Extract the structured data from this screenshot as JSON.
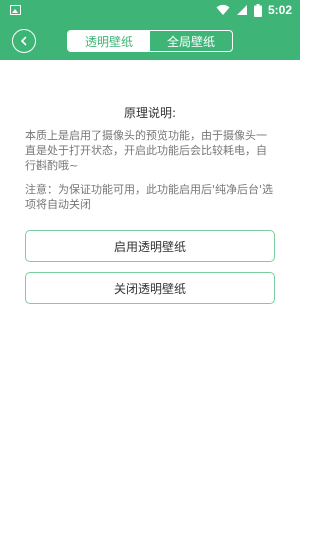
{
  "status_bar": {
    "time": "5:02",
    "icons": [
      "image-notification-icon",
      "wifi-icon",
      "signal-icon",
      "battery-icon"
    ]
  },
  "header": {
    "back_icon": "chevron-left-icon",
    "tabs": [
      {
        "label": "透明壁纸",
        "active": true
      },
      {
        "label": "全局壁纸",
        "active": false
      }
    ]
  },
  "content": {
    "title": "原理说明:",
    "description": "本质上是启用了摄像头的预览功能，由于摄像头一直是处于打开状态，开启此功能后会比较耗电，自行斟酌哦~",
    "note": "注意：为保证功能可用，此功能启用后'纯净后台'选项将自动关闭"
  },
  "buttons": {
    "enable": "启用透明壁纸",
    "disable": "关闭透明壁纸"
  },
  "colors": {
    "accent": "#3eb577",
    "button_border": "#7bcf9f"
  }
}
